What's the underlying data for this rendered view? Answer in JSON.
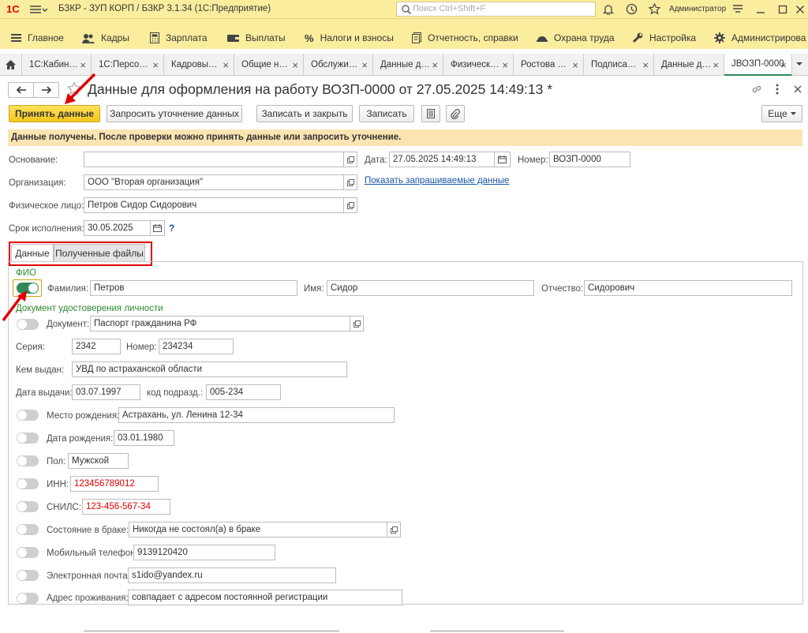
{
  "app": {
    "logo": "1С",
    "title": "БЗКР - ЗУП КОРП / БЗКР 3.1.34  (1С:Предприятие)",
    "search_placeholder": "Поиск Ctrl+Shift+F",
    "user": "Администратор"
  },
  "menu": [
    {
      "icon": "hamburger-icon",
      "label": "Главное"
    },
    {
      "icon": "people-icon",
      "label": "Кадры"
    },
    {
      "icon": "calculator-icon",
      "label": "Зарплата"
    },
    {
      "icon": "wallet-icon",
      "label": "Выплаты"
    },
    {
      "icon": "percent-icon",
      "label": "Налоги и взносы"
    },
    {
      "icon": "report-icon",
      "label": "Отчетность, справки"
    },
    {
      "icon": "helmet-icon",
      "label": "Охрана труда"
    },
    {
      "icon": "wrench-icon",
      "label": "Настройка"
    },
    {
      "icon": "gear-icon",
      "label": "Администрирова"
    }
  ],
  "open_tabs": [
    {
      "label": "1С:Кабин…"
    },
    {
      "label": "1С:Персо…"
    },
    {
      "label": "Кадровы…"
    },
    {
      "label": "Общие н…"
    },
    {
      "label": "Обслужи…"
    },
    {
      "label": "Данные д…"
    },
    {
      "label": "Физическ…"
    },
    {
      "label": "Ростова …"
    },
    {
      "label": "Подписа…"
    },
    {
      "label": "Данные д…"
    },
    {
      "label": "ЈВОЗП-0000"
    }
  ],
  "document": {
    "title": "Данные для оформления на работу ВОЗП-0000 от 27.05.2025 14:49:13 *"
  },
  "toolbar": {
    "accept": "Принять данные",
    "request": "Запросить уточнение данных",
    "save_close": "Записать и закрыть",
    "save": "Записать",
    "more": "Еще"
  },
  "info_message": "Данные получены. После проверки можно принять данные или запросить уточнение.",
  "header": {
    "basis_label": "Основание:",
    "basis_value": "",
    "date_label": "Дата:",
    "date_value": "27.05.2025 14:49:13",
    "number_label": "Номер:",
    "number_value": "ВОЗП-0000",
    "org_label": "Организация:",
    "org_value": "ООО \"Вторая организация\"",
    "show_requested_link": "Показать запрашиваемые данные",
    "person_label": "Физическое лицо:",
    "person_value": "Петров Сидор Сидорович",
    "due_label": "Срок исполнения:",
    "due_value": "30.05.2025",
    "help": "?"
  },
  "form_tabs": {
    "data": "Данные",
    "files": "Полученные файлы"
  },
  "fio": {
    "group_title": "ФИО",
    "surname_label": "Фамилия:",
    "surname_value": "Петров",
    "name_label": "Имя:",
    "name_value": "Сидор",
    "patronymic_label": "Отчество:",
    "patronymic_value": "Сидорович"
  },
  "id_doc": {
    "group_title": "Документ удостоверения личности",
    "doc_label": "Документ:",
    "doc_value": "Паспорт гражданина РФ",
    "series_label": "Серия:",
    "series_value": "2342",
    "number_label": "Номер:",
    "number_value": "234234",
    "issued_by_label": "Кем выдан:",
    "issued_by_value": "УВД по астраханской области",
    "issue_date_label": "Дата выдачи:",
    "issue_date_value": "03.07.1997",
    "dept_code_label": "код подразд.:",
    "dept_code_value": "005-234"
  },
  "fields": {
    "birthplace_label": "Место рождения:",
    "birthplace_value": "Астрахань, ул. Ленина 12-34",
    "birthdate_label": "Дата рождения:",
    "birthdate_value": "03.01.1980",
    "sex_label": "Пол:",
    "sex_value": "Мужской",
    "inn_label": "ИНН:",
    "inn_value": "123456789012",
    "snils_label": "СНИЛС:",
    "snils_value": "123-456-567-34",
    "marital_label": "Состояние в браке:",
    "marital_value": "Никогда не состоял(а) в браке",
    "phone_label": "Мобильный телефон:",
    "phone_value": "9139120420",
    "email_label": "Электронная почта:",
    "email_value": "s1ido@yandex.ru",
    "address_label": "Адрес проживания:",
    "address_value": "совпадает с адресом постоянной регистрации"
  },
  "colors": {
    "accent_yellow": "#fbed9e",
    "primary_button": "#f4c61c",
    "toggle_on": "#2e8b57",
    "annotation_red": "#e00000",
    "error_text": "#d00000",
    "group_green": "#2e8b2e"
  }
}
